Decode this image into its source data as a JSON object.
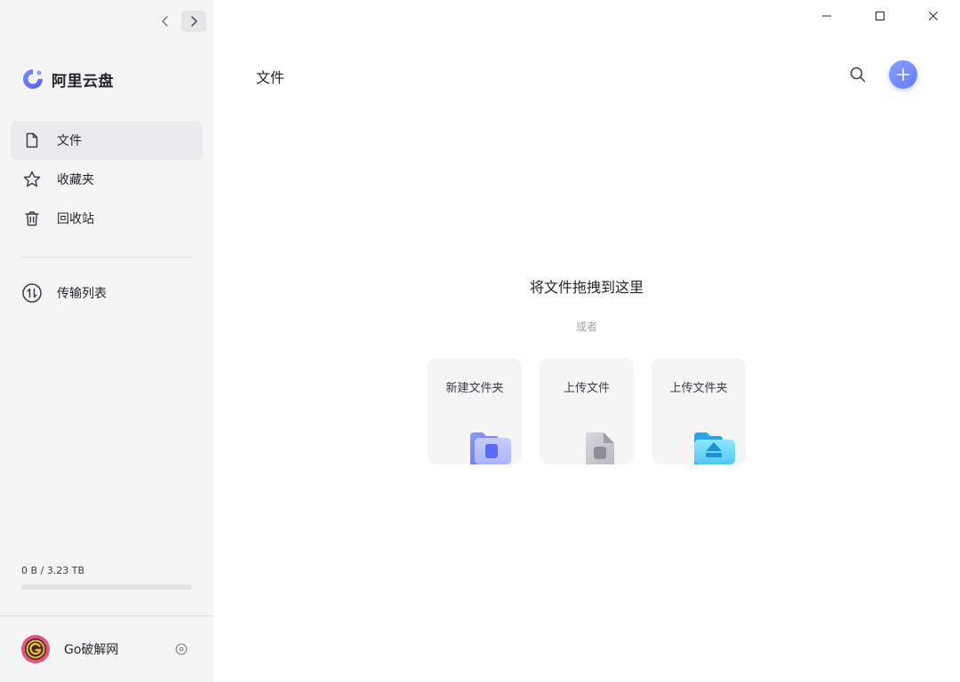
{
  "app": {
    "name": "阿里云盘"
  },
  "sidebar": {
    "items": [
      {
        "label": "文件",
        "icon": "file-icon",
        "selected": true
      },
      {
        "label": "收藏夹",
        "icon": "star-icon",
        "selected": false
      },
      {
        "label": "回收站",
        "icon": "trash-icon",
        "selected": false
      }
    ],
    "secondary_items": [
      {
        "label": "传输列表",
        "icon": "transfer-icon"
      }
    ],
    "storage": {
      "text": "0 B / 3.23 TB",
      "used_fraction": 0
    },
    "user": {
      "name": "Go破解网"
    }
  },
  "main": {
    "title": "文件",
    "empty_title": "将文件拖拽到这里",
    "empty_or": "或者",
    "actions": [
      {
        "label": "新建文件夹",
        "icon": "new-folder-icon"
      },
      {
        "label": "上传文件",
        "icon": "upload-file-icon"
      },
      {
        "label": "上传文件夹",
        "icon": "upload-folder-icon"
      }
    ]
  },
  "colors": {
    "accent": "#637dff",
    "sidebar_bg": "#f5f5f6",
    "avatar": "#e3537d"
  }
}
